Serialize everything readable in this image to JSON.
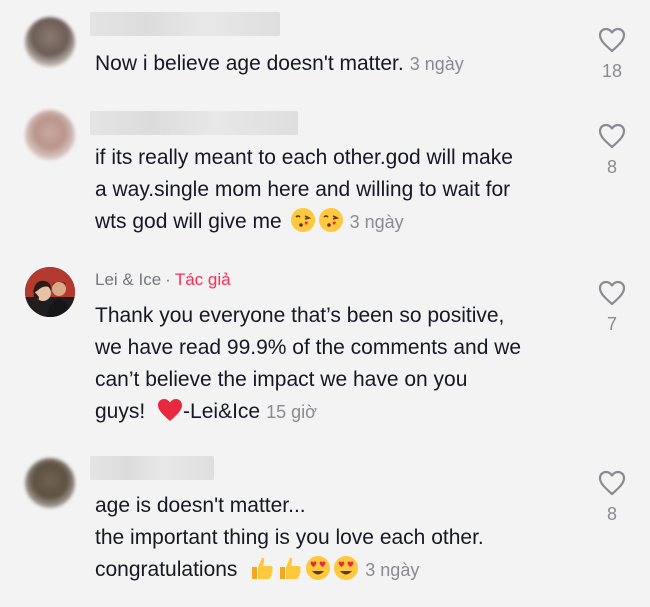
{
  "comments": [
    {
      "lines": [
        "Now i believe age doesn't matter."
      ],
      "time": "3 ngày",
      "likes": "18"
    },
    {
      "lines": [
        "if its really meant to each other.god will make",
        "a way.single mom here and willing to wait for",
        "wts god will give me"
      ],
      "time": "3 ngày",
      "likes": "8",
      "emojis": [
        "face-blowing-kiss-emoji",
        "face-blowing-kiss-emoji"
      ]
    },
    {
      "author": "Lei & Ice",
      "separator": "·",
      "author_tag": "Tác giả",
      "lines": [
        "Thank you everyone that’s been so positive,",
        "we have read 99.9% of the comments and we",
        "can’t believe the impact we have on you",
        "guys!"
      ],
      "after_emoji_text": "-Lei&Ice",
      "time": "15 giờ",
      "likes": "7",
      "emojis": [
        "red-heart-emoji"
      ]
    },
    {
      "lines": [
        "age is doesn't matter...",
        "the important thing is you love each other.",
        "congratulations"
      ],
      "time": "3 ngày",
      "likes": "8",
      "emojis": [
        "thumbs-up-emoji",
        "thumbs-up-emoji",
        "heart-eyes-emoji",
        "heart-eyes-emoji"
      ]
    }
  ]
}
